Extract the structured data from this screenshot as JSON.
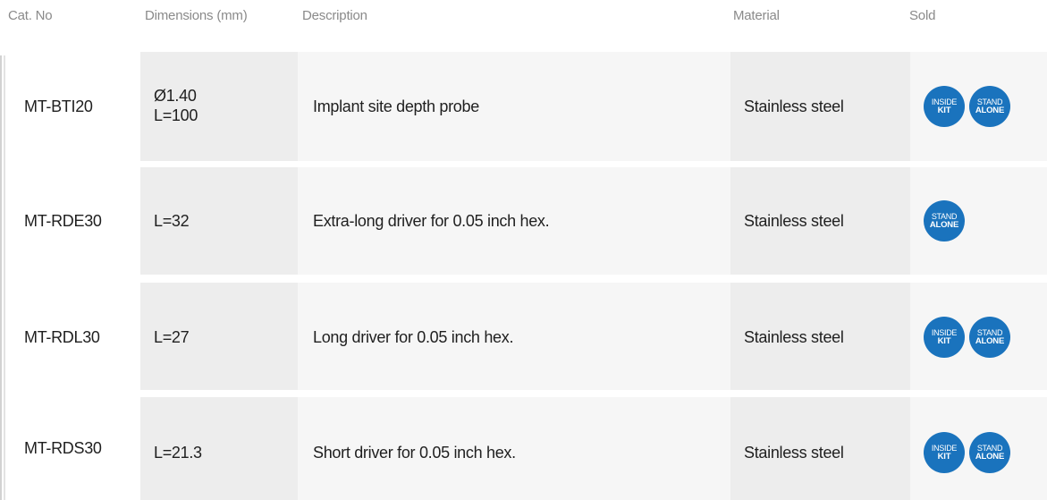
{
  "header": {
    "cat_no": "Cat. No",
    "dimensions": "Dimensions (mm)",
    "description": "Description",
    "material": "Material",
    "sold": "Sold"
  },
  "badge_labels": {
    "inside_kit": {
      "line1": "INSIDE",
      "line2": "KIT"
    },
    "stand_alone": {
      "line1": "STAND",
      "line2": "ALONE"
    }
  },
  "colors": {
    "badge": "#1a73bd",
    "header_text": "#8a8a8a",
    "cell_dark": "#ededed",
    "cell_light": "#f6f6f6"
  },
  "rows": [
    {
      "cat_no": "MT-BTI20",
      "dimensions": [
        "Ø1.40",
        "L=100"
      ],
      "description": "Implant site depth probe",
      "material": "Stainless steel",
      "sold": [
        "inside_kit",
        "stand_alone"
      ]
    },
    {
      "cat_no": "MT-RDE30",
      "dimensions": [
        "L=32"
      ],
      "description": "Extra-long driver for 0.05 inch hex.",
      "material": "Stainless steel",
      "sold": [
        "stand_alone"
      ]
    },
    {
      "cat_no": "MT-RDL30",
      "dimensions": [
        "L=27"
      ],
      "description": "Long driver for 0.05 inch hex.",
      "material": "Stainless steel",
      "sold": [
        "inside_kit",
        "stand_alone"
      ]
    },
    {
      "cat_no": "MT-RDS30",
      "dimensions": [
        "L=21.3"
      ],
      "description": "Short driver for 0.05 inch hex.",
      "material": "Stainless steel",
      "sold": [
        "inside_kit",
        "stand_alone"
      ]
    }
  ]
}
